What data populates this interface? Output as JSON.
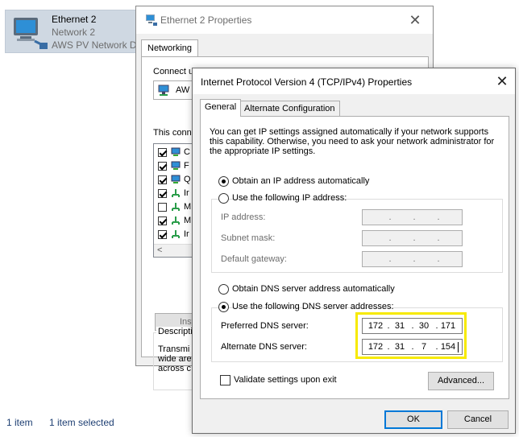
{
  "explorer": {
    "adapter": {
      "name": "Ethernet 2",
      "network": "Network 2",
      "description": "AWS PV Network Device"
    },
    "status": {
      "count": "1 item",
      "selected": "1 item selected"
    }
  },
  "ethernet_dialog": {
    "title": "Ethernet 2 Properties",
    "tab": "Networking",
    "connect_using_label": "Connect u",
    "adapter_short": "AW",
    "this_connection_label": "This conne",
    "items": [
      {
        "checked": true,
        "label": "C"
      },
      {
        "checked": true,
        "label": "F"
      },
      {
        "checked": true,
        "label": "Q"
      },
      {
        "checked": true,
        "label": "Ir"
      },
      {
        "checked": false,
        "label": "M"
      },
      {
        "checked": true,
        "label": "M"
      },
      {
        "checked": true,
        "label": "Ir"
      }
    ],
    "scroll_arrow": "<",
    "install_button": "Insti",
    "description_legend": "Descripti",
    "description_lines": [
      "Transmi",
      "wide are",
      "across c"
    ]
  },
  "ipv4_dialog": {
    "title": "Internet Protocol Version 4 (TCP/IPv4) Properties",
    "tabs": [
      "General",
      "Alternate Configuration"
    ],
    "intro_text": "You can get IP settings assigned automatically if your network supports this capability. Otherwise, you need to ask your network administrator for the appropriate IP settings.",
    "ip_auto_label": "Obtain an IP address automatically",
    "ip_manual_label": "Use the following IP address:",
    "ip_address_label": "IP address:",
    "subnet_label": "Subnet mask:",
    "gateway_label": "Default gateway:",
    "dns_auto_label": "Obtain DNS server address automatically",
    "dns_manual_label": "Use the following DNS server addresses:",
    "preferred_dns_label": "Preferred DNS server:",
    "alternate_dns_label": "Alternate DNS server:",
    "preferred_dns": {
      "o1": "172",
      "o2": "31",
      "o3": "30",
      "o4": "171"
    },
    "alternate_dns": {
      "o1": "172",
      "o2": "31",
      "o3": "7",
      "o4": "154"
    },
    "validate_label": "Validate settings upon exit",
    "advanced_button": "Advanced...",
    "ok_button": "OK",
    "cancel_button": "Cancel"
  },
  "colors": {
    "highlight": "#f7ea00",
    "accent": "#0078d7",
    "status_text": "#1e3f73"
  }
}
